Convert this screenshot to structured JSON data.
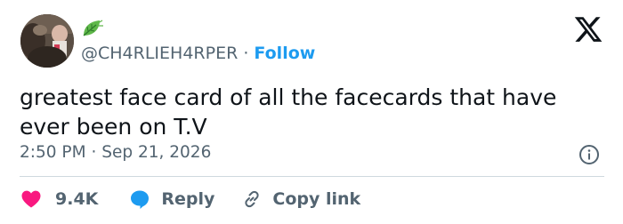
{
  "author": {
    "handle": "@CH4RLIEH4RPER",
    "separator": "·",
    "follow_label": "Follow",
    "avatar_icon": "profile-photo",
    "badge_icon": "leaf-icon"
  },
  "tweet": {
    "text": "greatest face card of all the facecards that have ever been on T.V",
    "time": "2:50 PM",
    "separator": "·",
    "date": "Sep 21, 2026"
  },
  "actions": {
    "like_count": "9.4K",
    "reply_label": "Reply",
    "copy_label": "Copy link"
  },
  "colors": {
    "text": "#0f1419",
    "secondary": "#536471",
    "accent": "#1d9bf0",
    "like": "#f91880",
    "divider": "#cfd9de",
    "leaf": "#5fb84a"
  }
}
